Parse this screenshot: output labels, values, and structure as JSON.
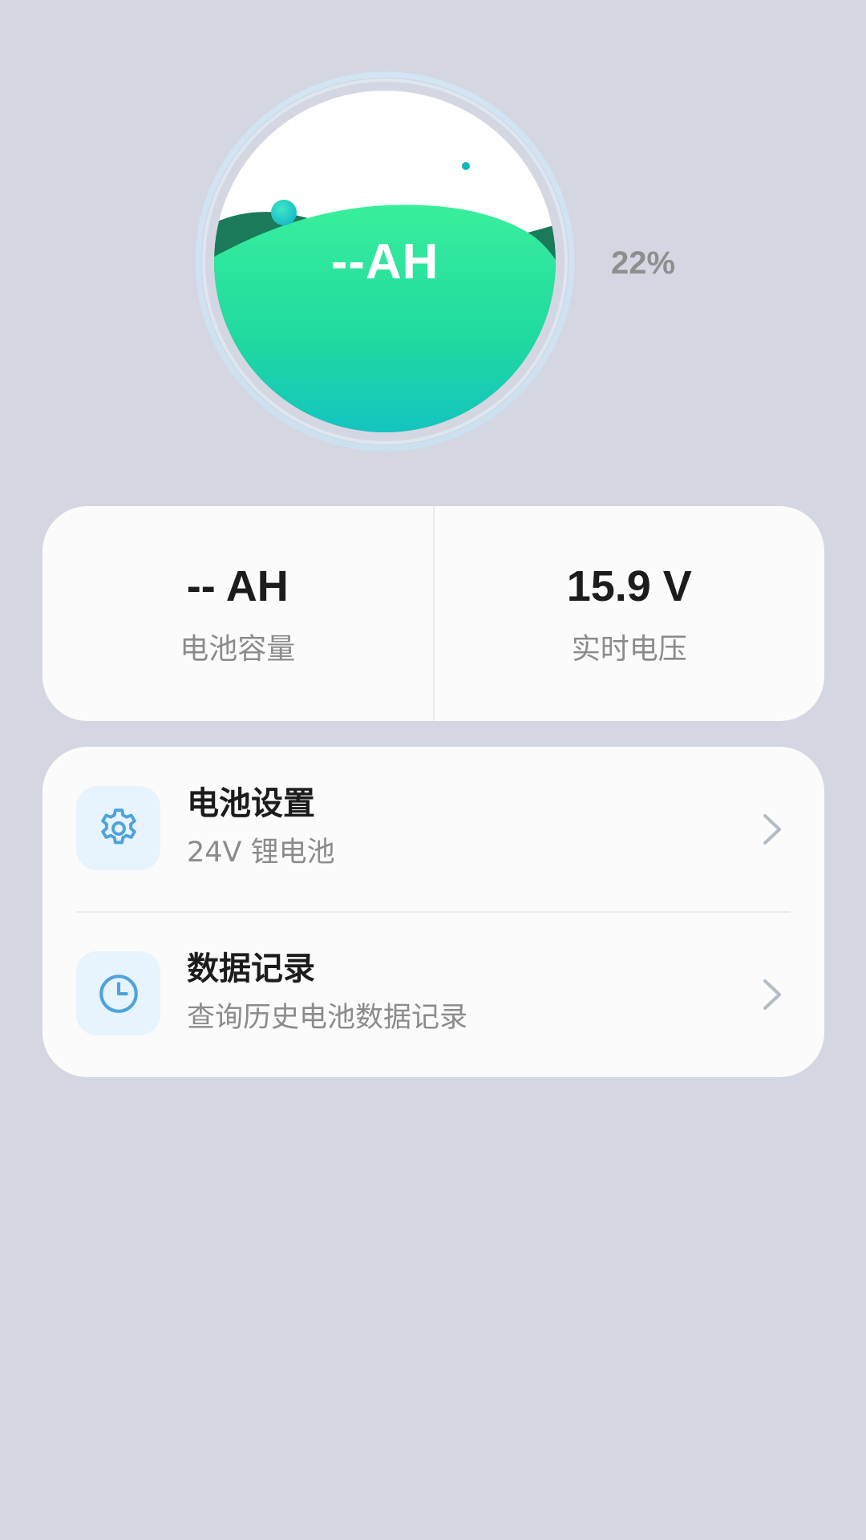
{
  "gauge": {
    "value_text": "--AH",
    "percent_text": "22%",
    "level": 0.22
  },
  "stats": {
    "capacity": {
      "value": "-- AH",
      "label": "电池容量"
    },
    "voltage": {
      "value": "15.9 V",
      "label": "实时电压"
    }
  },
  "menu": {
    "items": [
      {
        "icon": "gear-icon",
        "title": "电池设置",
        "subtitle": "24V 锂电池"
      },
      {
        "icon": "clock-icon",
        "title": "数据记录",
        "subtitle": "查询历史电池数据记录"
      }
    ]
  },
  "colors": {
    "background": "#d4d7e2",
    "card": "#fbfbfb",
    "accent_blue": "#4da3dc",
    "wave_green": "#22e098",
    "wave_teal": "#12c2c6",
    "wave_dark": "#1a7a5a"
  }
}
